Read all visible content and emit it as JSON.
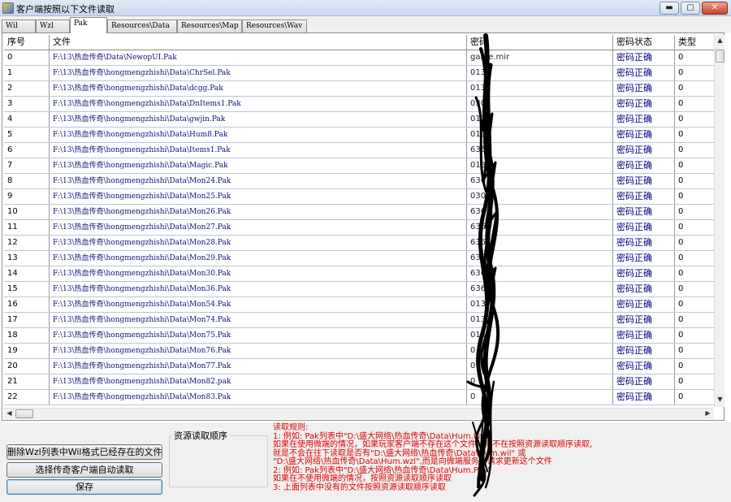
{
  "window": {
    "title": "客户端按照以下文件读取",
    "min_label": "▬",
    "max_label": "▢",
    "close_label": "✕"
  },
  "tabs": [
    {
      "label": "Wil",
      "active": false
    },
    {
      "label": "Wzl",
      "active": false
    },
    {
      "label": "Pak",
      "active": true
    },
    {
      "label": "Resources\\Data",
      "active": false
    },
    {
      "label": "Resources\\Map",
      "active": false
    },
    {
      "label": "Resources\\Wav",
      "active": false
    }
  ],
  "table": {
    "columns": [
      "序号",
      "文件",
      "密码",
      "密码状态",
      "类型"
    ],
    "rows": [
      {
        "idx": "0",
        "path": "F:\\13\\热血传奇\\Data\\NewopUI.Pak",
        "pw": "game.mir",
        "status": "密码正确",
        "type": "0"
      },
      {
        "idx": "1",
        "path": "F:\\13\\热血传奇\\hongmengzhishi\\Data\\ChrSel.Pak",
        "pw": "013",
        "status": "密码正确",
        "type": "0"
      },
      {
        "idx": "2",
        "path": "F:\\13\\热血传奇\\hongmengzhishi\\Data\\dcgg.Pak",
        "pw": "013",
        "status": "密码正确",
        "type": "0"
      },
      {
        "idx": "3",
        "path": "F:\\13\\热血传奇\\hongmengzhishi\\Data\\DnItems1.Pak",
        "pw": "030",
        "status": "密码正确",
        "type": "0"
      },
      {
        "idx": "4",
        "path": "F:\\13\\热血传奇\\hongmengzhishi\\Data\\gwjin.Pak",
        "pw": "013",
        "status": "密码正确",
        "type": "0"
      },
      {
        "idx": "5",
        "path": "F:\\13\\热血传奇\\hongmengzhishi\\Data\\Hum8.Pak",
        "pw": "013",
        "status": "密码正确",
        "type": "0"
      },
      {
        "idx": "6",
        "path": "F:\\13\\热血传奇\\hongmengzhishi\\Data\\Items1.Pak",
        "pw": "636",
        "status": "密码正确",
        "type": "0"
      },
      {
        "idx": "7",
        "path": "F:\\13\\热血传奇\\hongmengzhishi\\Data\\Magic.Pak",
        "pw": "013",
        "status": "密码正确",
        "type": "0"
      },
      {
        "idx": "8",
        "path": "F:\\13\\热血传奇\\hongmengzhishi\\Data\\Mon24.Pak",
        "pw": "636",
        "status": "密码正确",
        "type": "0"
      },
      {
        "idx": "9",
        "path": "F:\\13\\热血传奇\\hongmengzhishi\\Data\\Mon25.Pak",
        "pw": "030",
        "status": "密码正确",
        "type": "0"
      },
      {
        "idx": "10",
        "path": "F:\\13\\热血传奇\\hongmengzhishi\\Data\\Mon26.Pak",
        "pw": "636",
        "status": "密码正确",
        "type": "0"
      },
      {
        "idx": "11",
        "path": "F:\\13\\热血传奇\\hongmengzhishi\\Data\\Mon27.Pak",
        "pw": "636",
        "status": "密码正确",
        "type": "0"
      },
      {
        "idx": "12",
        "path": "F:\\13\\热血传奇\\hongmengzhishi\\Data\\Mon28.Pak",
        "pw": "636",
        "status": "密码正确",
        "type": "0"
      },
      {
        "idx": "13",
        "path": "F:\\13\\热血传奇\\hongmengzhishi\\Data\\Mon29.Pak",
        "pw": "636",
        "status": "密码正确",
        "type": "0"
      },
      {
        "idx": "14",
        "path": "F:\\13\\热血传奇\\hongmengzhishi\\Data\\Mon30.Pak",
        "pw": "636",
        "status": "密码正确",
        "type": "0"
      },
      {
        "idx": "15",
        "path": "F:\\13\\热血传奇\\hongmengzhishi\\Data\\Mon36.Pak",
        "pw": "636",
        "status": "密码正确",
        "type": "0"
      },
      {
        "idx": "16",
        "path": "F:\\13\\热血传奇\\hongmengzhishi\\Data\\Mon54.Pak",
        "pw": "013",
        "status": "密码正确",
        "type": "0"
      },
      {
        "idx": "17",
        "path": "F:\\13\\热血传奇\\hongmengzhishi\\Data\\Mon74.Pak",
        "pw": "013",
        "status": "密码正确",
        "type": "0"
      },
      {
        "idx": "18",
        "path": "F:\\13\\热血传奇\\hongmengzhishi\\Data\\Mon75.Pak",
        "pw": "013",
        "status": "密码正确",
        "type": "0"
      },
      {
        "idx": "19",
        "path": "F:\\13\\热血传奇\\hongmengzhishi\\Data\\Mon76.Pak",
        "pw": "0",
        "status": "密码正确",
        "type": "0"
      },
      {
        "idx": "20",
        "path": "F:\\13\\热血传奇\\hongmengzhishi\\Data\\Mon77.Pak",
        "pw": "0",
        "status": "密码正确",
        "type": "0"
      },
      {
        "idx": "21",
        "path": "F:\\13\\热血传奇\\hongmengzhishi\\Data\\Mon82.pak",
        "pw": "0",
        "status": "密码正确",
        "type": "0"
      },
      {
        "idx": "22",
        "path": "F:\\13\\热血传奇\\hongmengzhishi\\Data\\Mon83.Pak",
        "pw": "0",
        "status": "密码正确",
        "type": "0"
      }
    ]
  },
  "scroll": {
    "up": "▲",
    "down": "▼",
    "left": "◀",
    "right": "▶"
  },
  "buttons": {
    "delete_label": "删除Wzl列表中Wil格式已经存在的文件",
    "select_label": "选择传奇客户端自动读取",
    "save_label": "保存"
  },
  "group": {
    "title": "资源读取顺序"
  },
  "rules": [
    "读取规则:",
    "1: 例如: Pak列表中\"D:\\盛大网络\\热血传奇\\Data\\Hum.Pak\"",
    "    如果在使用微端的情况，如果玩家客户端不存在这个文件，就不在按照资源读取顺序读取,",
    "    就是不会在往下读取是否有\"D:\\盛大网络\\热血传奇\\Data\\Hum.wil\" 或",
    "    \"D:\\盛大网络\\热血传奇\\Data\\Hum.wzl\",而是向微端服务器请求更新这个文件",
    "2: 例如: Pak列表中\"D:\\盛大网络\\热血传奇\\Data\\Hum.Pak\"",
    "    如果在不使用微端的情况，按照资源读取顺序读取",
    "3: 上面列表中没有的文件按照资源读取顺序读取"
  ]
}
